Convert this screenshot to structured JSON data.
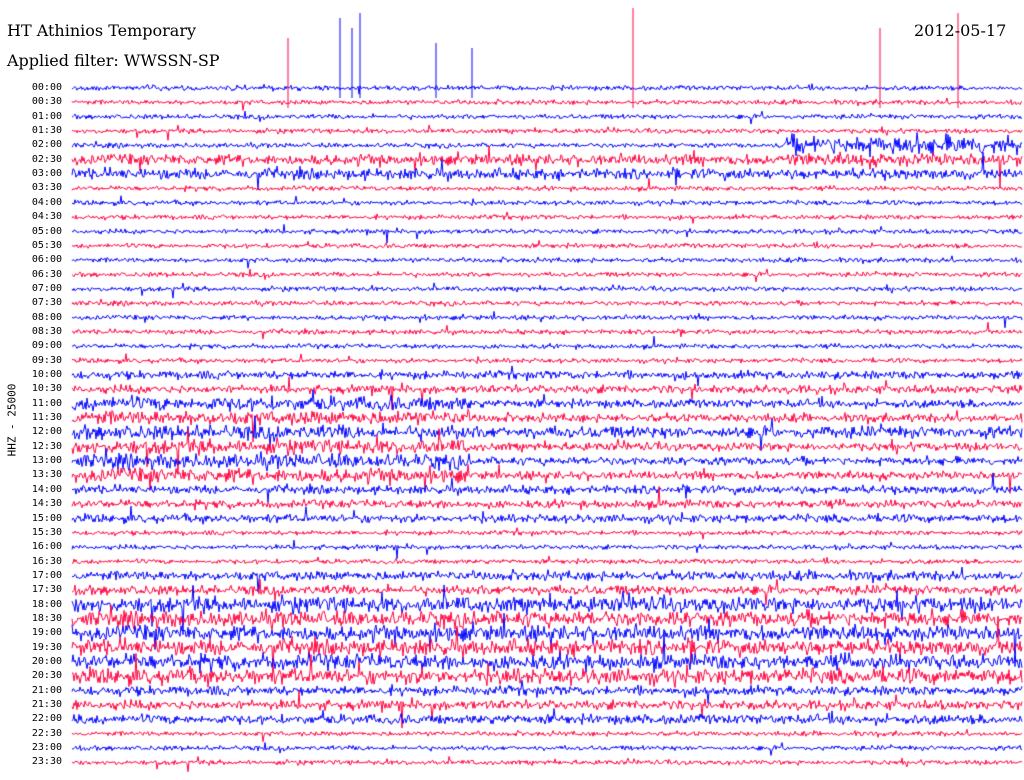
{
  "chart_data": {
    "type": "line",
    "title": "HT Athinios Temporary",
    "subtitle": "Applied filter: WWSSN-SP",
    "date": "2012-05-17",
    "ylabel": "HHZ - 25000",
    "xlabel": "",
    "time_ticks": [
      "00:00",
      "00:30",
      "01:00",
      "01:30",
      "02:00",
      "02:30",
      "03:00",
      "03:30",
      "04:00",
      "04:30",
      "05:00",
      "05:30",
      "06:00",
      "06:30",
      "07:00",
      "07:30",
      "08:00",
      "08:30",
      "09:00",
      "09:30",
      "10:00",
      "10:30",
      "11:00",
      "11:30",
      "12:00",
      "12:30",
      "13:00",
      "13:30",
      "14:00",
      "14:30",
      "15:00",
      "15:30",
      "16:00",
      "16:30",
      "17:00",
      "17:30",
      "18:00",
      "18:30",
      "19:00",
      "19:30",
      "20:00",
      "20:30",
      "21:00",
      "21:30",
      "22:00",
      "22:30",
      "23:00",
      "23:30"
    ],
    "trace_colors": [
      "#0000ff",
      "#ff0040"
    ],
    "grid": false,
    "legend": "none"
  }
}
